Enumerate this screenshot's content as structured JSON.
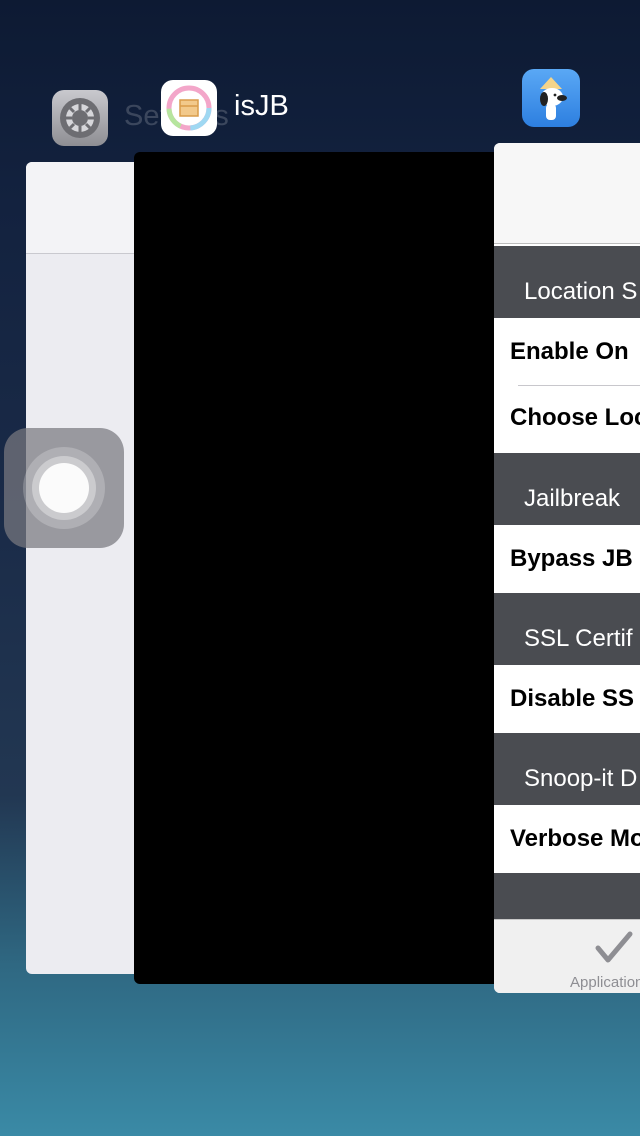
{
  "switcher": {
    "settings_app": {
      "name": "Settings"
    },
    "isjb_app": {
      "name": "isJB"
    },
    "snoopit_app": {
      "sections": [
        {
          "header": "Location S",
          "rows": [
            "Enable On",
            "Choose Loc"
          ]
        },
        {
          "header": "Jailbreak",
          "rows": [
            "Bypass JB"
          ]
        },
        {
          "header": "SSL Certif",
          "rows": [
            "Disable SS"
          ]
        },
        {
          "header": "Snoop-it D",
          "rows": [
            "Verbose Mo"
          ]
        }
      ],
      "tab_label": "Applications"
    }
  },
  "colors": {
    "section_header": "#4a4c51",
    "wallpaper_top": "#0d1a33",
    "wallpaper_bottom": "#3a8aa6"
  }
}
